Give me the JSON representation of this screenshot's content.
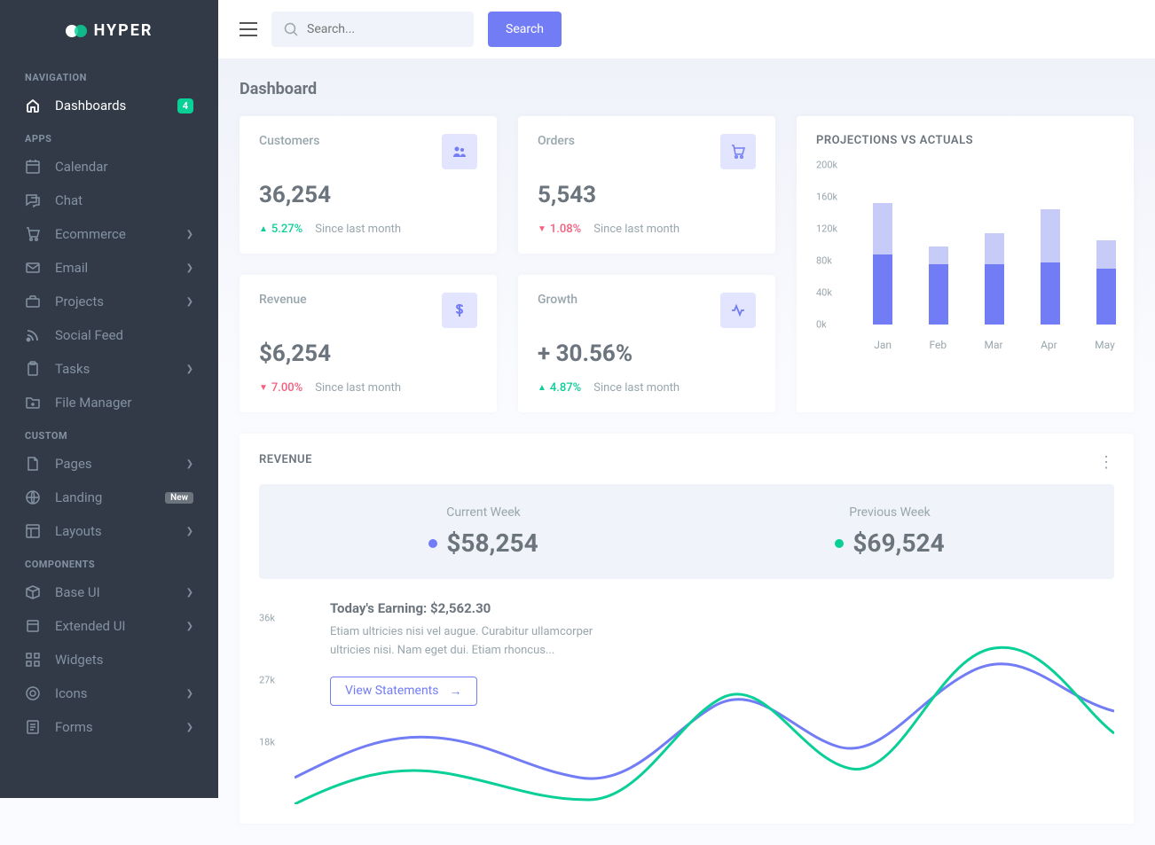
{
  "brand": "HYPER",
  "search": {
    "placeholder": "Search...",
    "button": "Search"
  },
  "sidebar": {
    "sections": [
      {
        "title": "NAVIGATION",
        "items": [
          {
            "label": "Dashboards",
            "icon": "home",
            "active": true,
            "badge_count": "4"
          }
        ]
      },
      {
        "title": "APPS",
        "items": [
          {
            "label": "Calendar",
            "icon": "calendar"
          },
          {
            "label": "Chat",
            "icon": "chat"
          },
          {
            "label": "Ecommerce",
            "icon": "cart",
            "expandable": true
          },
          {
            "label": "Email",
            "icon": "mail",
            "expandable": true
          },
          {
            "label": "Projects",
            "icon": "briefcase",
            "expandable": true
          },
          {
            "label": "Social Feed",
            "icon": "rss"
          },
          {
            "label": "Tasks",
            "icon": "clipboard",
            "expandable": true
          },
          {
            "label": "File Manager",
            "icon": "folder"
          }
        ]
      },
      {
        "title": "CUSTOM",
        "items": [
          {
            "label": "Pages",
            "icon": "file",
            "expandable": true
          },
          {
            "label": "Landing",
            "icon": "globe",
            "badge_new": "New"
          },
          {
            "label": "Layouts",
            "icon": "layout",
            "expandable": true
          }
        ]
      },
      {
        "title": "COMPONENTS",
        "items": [
          {
            "label": "Base UI",
            "icon": "box",
            "expandable": true
          },
          {
            "label": "Extended UI",
            "icon": "package",
            "expandable": true
          },
          {
            "label": "Widgets",
            "icon": "widgets"
          },
          {
            "label": "Icons",
            "icon": "target",
            "expandable": true
          },
          {
            "label": "Forms",
            "icon": "form",
            "expandable": true
          }
        ]
      }
    ]
  },
  "page_title": "Dashboard",
  "stats": [
    {
      "label": "Customers",
      "value": "36,254",
      "trend": "up",
      "pct": "5.27%",
      "since": "Since last month",
      "icon": "users"
    },
    {
      "label": "Orders",
      "value": "5,543",
      "trend": "down",
      "pct": "1.08%",
      "since": "Since last month",
      "icon": "cart"
    },
    {
      "label": "Revenue",
      "value": "$6,254",
      "trend": "down",
      "pct": "7.00%",
      "since": "Since last month",
      "icon": "dollar"
    },
    {
      "label": "Growth",
      "value": "+ 30.56%",
      "trend": "up",
      "pct": "4.87%",
      "since": "Since last month",
      "icon": "pulse"
    }
  ],
  "projections": {
    "title": "PROJECTIONS VS ACTUALS"
  },
  "chart_data": {
    "projections": {
      "type": "bar",
      "categories": [
        "Jan",
        "Feb",
        "Mar",
        "Apr",
        "May"
      ],
      "series": [
        {
          "name": "Actuals",
          "values": [
            88000,
            76000,
            76000,
            78000,
            70000
          ]
        },
        {
          "name": "Projections",
          "values": [
            152000,
            98000,
            114000,
            144000,
            106000
          ]
        }
      ],
      "ylim": [
        0,
        200000
      ],
      "yticks": [
        "0k",
        "40k",
        "80k",
        "120k",
        "160k",
        "200k"
      ]
    },
    "revenue_line": {
      "type": "line",
      "yticks": [
        "18k",
        "27k",
        "36k"
      ],
      "series": [
        {
          "name": "Current Week",
          "color": "#727cf5"
        },
        {
          "name": "Previous Week",
          "color": "#0acf97"
        }
      ]
    }
  },
  "revenue": {
    "title": "REVENUE",
    "current_label": "Current Week",
    "current_value": "$58,254",
    "previous_label": "Previous Week",
    "previous_value": "$69,524",
    "earning_prefix": "Today's Earning: ",
    "earning_value": "$2,562.30",
    "desc": "Etiam ultricies nisi vel augue. Curabitur ullamcorper ultricies nisi. Nam eget dui. Etiam rhoncus...",
    "button": "View Statements"
  }
}
